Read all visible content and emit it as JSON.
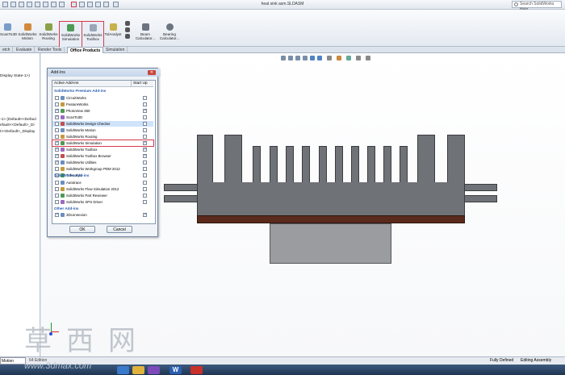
{
  "window": {
    "title": "heat sink asm.SLDASM",
    "search_placeholder": "Search SolidWorks Help"
  },
  "ribbon": {
    "buttons": [
      {
        "label": "ScanTo3D"
      },
      {
        "label": "SolidWorks Motion"
      },
      {
        "label": "SolidWorks Routing"
      },
      {
        "label": "SolidWorks Simulation"
      },
      {
        "label": "SolidWorks Toolbox"
      },
      {
        "label": "TolAnalyst"
      },
      {
        "label": "Beam Calculator..."
      },
      {
        "label": "Bearing Calculator..."
      }
    ]
  },
  "tabs": [
    {
      "label": "etch"
    },
    {
      "label": "Evaluate"
    },
    {
      "label": "Render Tools"
    },
    {
      "label": "Office Products"
    },
    {
      "label": "Simulation"
    }
  ],
  "tree": {
    "line1": "Display State-1>)",
    "line2": "-1> (Default<<Defaul",
    "line3": "efault<<Default>_Di",
    "line4": "t><Default>_Display"
  },
  "dialog": {
    "title": "Add-Ins",
    "col_active": "Active Add-ins",
    "col_startup": "Start Up",
    "group_premium": "SolidWorks Premium Add-ins",
    "premium": [
      {
        "label": "CircuitWorks",
        "active": false,
        "startup": false
      },
      {
        "label": "FeatureWorks",
        "active": false,
        "startup": false
      },
      {
        "label": "PhotoView 360",
        "active": true,
        "startup": true
      },
      {
        "label": "ScanTo3D",
        "active": true,
        "startup": false
      },
      {
        "label": "SolidWorks Design Checker",
        "active": false,
        "startup": false
      },
      {
        "label": "SolidWorks Motion",
        "active": false,
        "startup": false
      },
      {
        "label": "SolidWorks Routing",
        "active": false,
        "startup": false
      },
      {
        "label": "SolidWorks Simulation",
        "active": true,
        "startup": true
      },
      {
        "label": "SolidWorks Toolbox",
        "active": true,
        "startup": true
      },
      {
        "label": "SolidWorks Toolbox Browser",
        "active": true,
        "startup": true
      },
      {
        "label": "SolidWorks Utilities",
        "active": true,
        "startup": false
      },
      {
        "label": "SolidWorks Workgroup PDM 2012",
        "active": false,
        "startup": false
      },
      {
        "label": "TolAnalyst",
        "active": false,
        "startup": false
      }
    ],
    "group_addins": "SolidWorks Add-ins",
    "addins": [
      {
        "label": "Autotrace",
        "active": false,
        "startup": false
      },
      {
        "label": "SolidWorks Flow Simulation 2012",
        "active": false,
        "startup": false
      },
      {
        "label": "SolidWorks Part Reviewer",
        "active": false,
        "startup": false
      },
      {
        "label": "SolidWorks XPS Driver",
        "active": false,
        "startup": false
      }
    ],
    "group_other": "Other Add-ins",
    "other": [
      {
        "label": "3Dconnexion",
        "active": true,
        "startup": true
      }
    ],
    "ok": "OK",
    "cancel": "Cancel"
  },
  "status": {
    "study": "Motion Study 1",
    "edition": "64 Edition",
    "state": "Fully Defined",
    "mode": "Editing Assembly"
  },
  "watermark": {
    "chars": "草西网",
    "url": "www.3dmax.com"
  },
  "colors": {
    "accent": "#d63a4a",
    "heatsink": "#6f7276",
    "plate": "#5a2a1d",
    "block": "#9a9ca0"
  }
}
